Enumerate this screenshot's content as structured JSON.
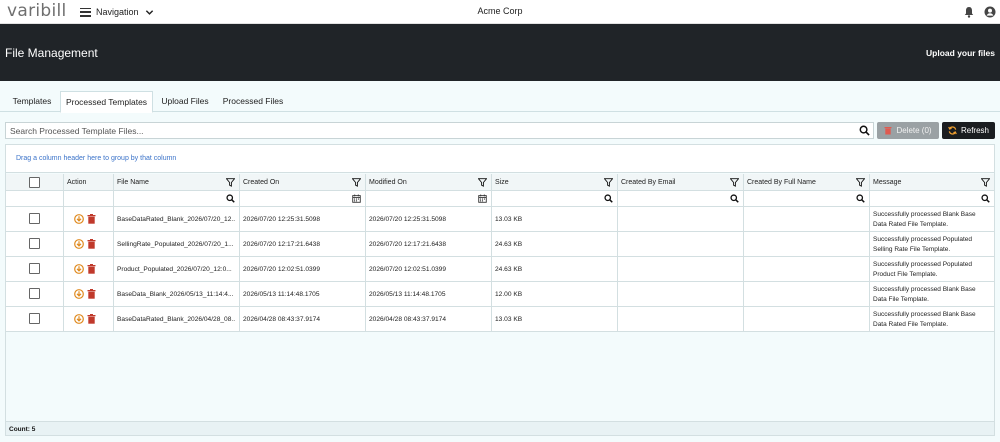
{
  "app": {
    "logo": "varibill",
    "nav_label": "Navigation",
    "company": "Acme Corp"
  },
  "banner": {
    "title": "File Management",
    "upload_link": "Upload your files"
  },
  "tabs": [
    {
      "label": "Templates"
    },
    {
      "label": "Processed Templates",
      "active": true
    },
    {
      "label": "Upload Files"
    },
    {
      "label": "Processed Files"
    }
  ],
  "toolbar": {
    "search_placeholder": "Search Processed Template Files...",
    "delete_label": "Delete (0)",
    "refresh_label": "Refresh"
  },
  "grid": {
    "group_hint": "Drag a column header here to group by that column",
    "columns": [
      "Action",
      "File Name",
      "Created On",
      "Modified On",
      "Size",
      "Created By Email",
      "Created By Full Name",
      "Message"
    ],
    "rows": [
      {
        "file_name": "BaseDataRated_Blank_2026/07/20_12...",
        "created_on": "2026/07/20 12:25:31.5098",
        "modified_on": "2026/07/20 12:25:31.5098",
        "size": "13.03 KB",
        "email": "",
        "full_name": "",
        "message": "Successfully processed Blank Base Data Rated File Template."
      },
      {
        "file_name": "SellingRate_Populated_2026/07/20_1...",
        "created_on": "2026/07/20 12:17:21.6438",
        "modified_on": "2026/07/20 12:17:21.6438",
        "size": "24.63 KB",
        "email": "",
        "full_name": "",
        "message": "Successfully processed Populated Selling Rate File Template."
      },
      {
        "file_name": "Product_Populated_2026/07/20_12:0...",
        "created_on": "2026/07/20 12:02:51.0399",
        "modified_on": "2026/07/20 12:02:51.0399",
        "size": "24.63 KB",
        "email": "",
        "full_name": "",
        "message": "Successfully processed Populated Product File Template."
      },
      {
        "file_name": "BaseData_Blank_2026/05/13_11:14:4...",
        "created_on": "2026/05/13 11:14:48.1705",
        "modified_on": "2026/05/13 11:14:48.1705",
        "size": "12.00 KB",
        "email": "",
        "full_name": "",
        "message": "Successfully processed Blank Base Data File Template."
      },
      {
        "file_name": "BaseDataRated_Blank_2026/04/28_08...",
        "created_on": "2026/04/28 08:43:37.9174",
        "modified_on": "2026/04/28 08:43:37.9174",
        "size": "13.03 KB",
        "email": "",
        "full_name": "",
        "message": "Successfully processed Blank Base Data Rated File Template."
      }
    ],
    "count_label": "Count: 5"
  },
  "colors": {
    "banner": "#202428",
    "accent_link": "#3b73c9",
    "delete_icon": "#c0392b",
    "download_icon": "#e08a1e"
  }
}
